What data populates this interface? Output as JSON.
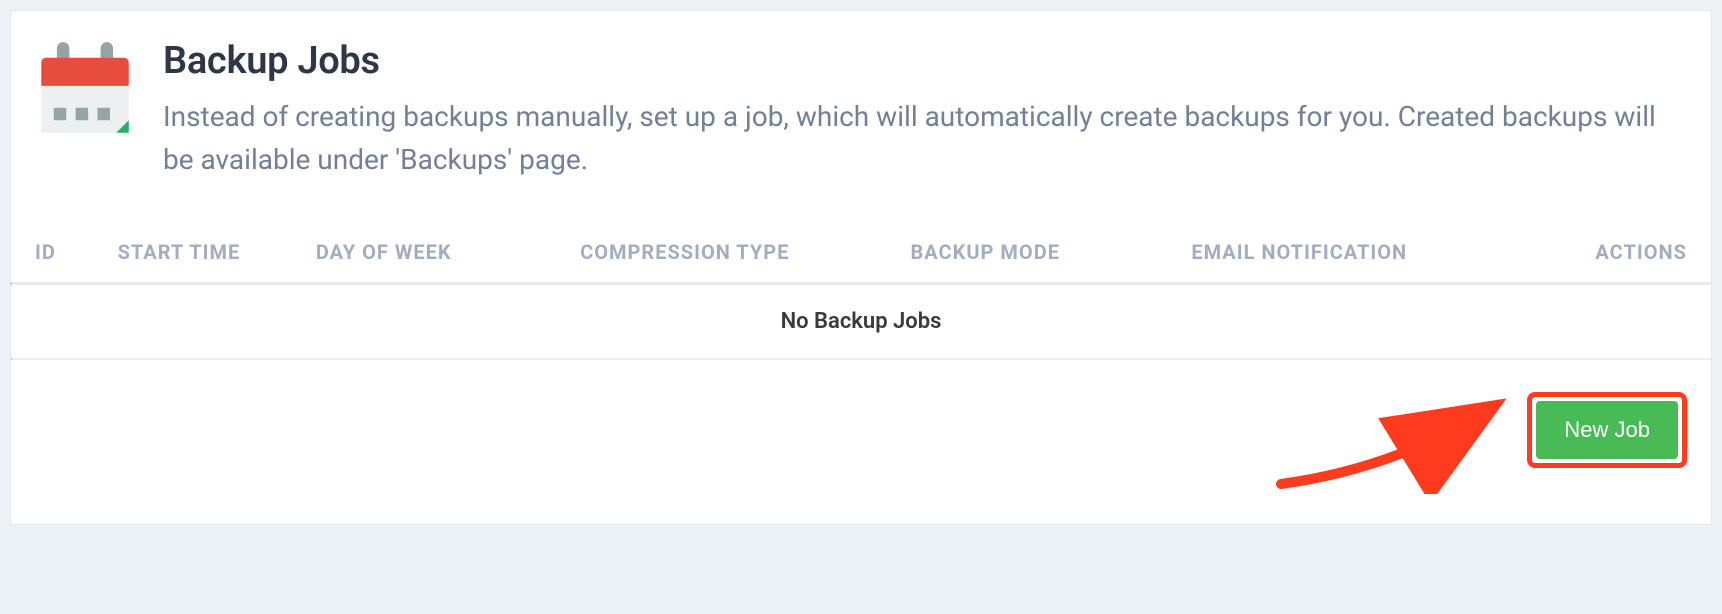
{
  "header": {
    "title": "Backup Jobs",
    "description": "Instead of creating backups manually, set up a job, which will automatically create backups for you. Created backups will be available under 'Backups' page."
  },
  "table": {
    "columns": {
      "id": "ID",
      "start_time": "START TIME",
      "day_of_week": "DAY OF WEEK",
      "compression_type": "COMPRESSION TYPE",
      "backup_mode": "BACKUP MODE",
      "email_notification": "EMAIL NOTIFICATION",
      "actions": "ACTIONS"
    },
    "empty_message": "No Backup Jobs"
  },
  "footer": {
    "new_job_label": "New Job"
  }
}
